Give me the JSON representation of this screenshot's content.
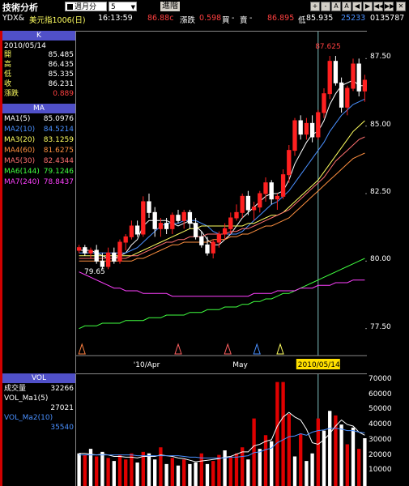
{
  "title": "技術分析",
  "toolbar": {
    "period_label": "週月分",
    "period_value": "5",
    "advanced_label": "進階",
    "buttons": [
      "A",
      "A",
      "+",
      "-",
      "◀",
      "▶",
      "◀◀",
      "▶▶",
      "✕"
    ]
  },
  "quote": {
    "symbol": "YDX&",
    "name": "美元指1006(日)",
    "time": "16:13:59",
    "last": "86.88c",
    "change_label": "漲跌",
    "change": "0.598",
    "bid_label": "買",
    "bid": "-",
    "ask_label": "賣",
    "ask": "86.895",
    "low_label": "低",
    "low": "85.935",
    "volume": "25233",
    "volume2": "0135787"
  },
  "k_panel": {
    "header": "K",
    "date": "2010/05/14",
    "rows": [
      {
        "label": "開",
        "value": "85.485"
      },
      {
        "label": "高",
        "value": "86.435"
      },
      {
        "label": "低",
        "value": "85.335"
      },
      {
        "label": "收",
        "value": "86.231"
      },
      {
        "label": "漲跌",
        "value": "0.889"
      }
    ]
  },
  "ma_panel": {
    "header": "MA",
    "rows": [
      {
        "label": "MA1(5)",
        "value": "85.0976",
        "color": "#ffffff"
      },
      {
        "label": "MA2(10)",
        "value": "84.5214",
        "color": "#4a90ff"
      },
      {
        "label": "MA3(20)",
        "value": "83.1259",
        "color": "#ffff60"
      },
      {
        "label": "MA4(60)",
        "value": "81.6275",
        "color": "#ff9040"
      },
      {
        "label": "MA5(30)",
        "value": "82.4344",
        "color": "#ff7070"
      },
      {
        "label": "MA6(144)",
        "value": "79.1246",
        "color": "#40ff40"
      },
      {
        "label": "MA7(240)",
        "value": "78.8437",
        "color": "#ff40ff"
      }
    ]
  },
  "vol_panel": {
    "header": "VOL",
    "rows": [
      {
        "label": "成交量",
        "value": "32266"
      },
      {
        "label": "VOL_Ma1(5)",
        "value": "27021"
      },
      {
        "label": "VOL_Ma2(10)",
        "value": "35540"
      }
    ]
  },
  "chart_data": {
    "type": "candlestick",
    "y_ticks": [
      "87.50",
      "85.00",
      "82.50",
      "80.00",
      "77.50"
    ],
    "ylim": [
      76.5,
      88.5
    ],
    "x_labels": [
      "'10/Apr",
      "May",
      "2010/05/14"
    ],
    "annotations": [
      {
        "text": "87.625",
        "price": 87.625
      },
      {
        "text": "79.65",
        "price": 79.65
      }
    ],
    "candles": [
      [
        80.4,
        80.6,
        80.3,
        80.5
      ],
      [
        80.5,
        80.6,
        80.2,
        80.3
      ],
      [
        80.3,
        80.5,
        80.1,
        80.4
      ],
      [
        80.4,
        80.6,
        79.9,
        80.0
      ],
      [
        80.0,
        80.3,
        79.7,
        79.8
      ],
      [
        79.8,
        80.5,
        79.7,
        80.3
      ],
      [
        80.3,
        80.5,
        79.9,
        80.0
      ],
      [
        80.0,
        80.8,
        79.9,
        80.7
      ],
      [
        80.7,
        81.0,
        80.4,
        80.9
      ],
      [
        80.9,
        81.5,
        80.8,
        81.3
      ],
      [
        81.3,
        81.5,
        80.9,
        81.0
      ],
      [
        81.0,
        82.4,
        80.9,
        82.2
      ],
      [
        82.2,
        82.5,
        81.6,
        81.8
      ],
      [
        81.8,
        82.0,
        80.9,
        81.2
      ],
      [
        81.2,
        81.6,
        80.9,
        81.4
      ],
      [
        81.4,
        81.6,
        81.0,
        81.2
      ],
      [
        81.2,
        81.8,
        81.0,
        81.7
      ],
      [
        81.7,
        81.9,
        81.4,
        81.5
      ],
      [
        81.5,
        81.9,
        81.2,
        81.8
      ],
      [
        81.8,
        81.9,
        81.2,
        81.4
      ],
      [
        81.4,
        81.6,
        80.8,
        80.9
      ],
      [
        80.9,
        81.1,
        80.5,
        80.6
      ],
      [
        80.6,
        80.9,
        80.2,
        80.3
      ],
      [
        80.3,
        80.8,
        80.1,
        80.7
      ],
      [
        80.7,
        81.1,
        80.5,
        81.0
      ],
      [
        81.0,
        81.4,
        80.8,
        81.2
      ],
      [
        81.2,
        81.8,
        81.0,
        81.6
      ],
      [
        81.6,
        82.1,
        81.5,
        81.8
      ],
      [
        81.8,
        82.5,
        81.6,
        82.4
      ],
      [
        82.4,
        82.6,
        81.7,
        81.9
      ],
      [
        81.9,
        82.2,
        81.5,
        82.0
      ],
      [
        82.0,
        82.6,
        81.8,
        82.5
      ],
      [
        82.5,
        83.1,
        82.2,
        82.9
      ],
      [
        82.9,
        83.0,
        82.1,
        82.3
      ],
      [
        82.3,
        82.5,
        81.9,
        82.4
      ],
      [
        82.4,
        83.4,
        82.3,
        83.2
      ],
      [
        83.2,
        84.3,
        82.9,
        84.1
      ],
      [
        84.1,
        85.3,
        83.9,
        85.2
      ],
      [
        85.2,
        85.4,
        84.5,
        84.7
      ],
      [
        84.7,
        85.3,
        84.5,
        85.1
      ],
      [
        85.1,
        85.4,
        84.4,
        84.6
      ],
      [
        84.6,
        85.6,
        84.5,
        85.5
      ],
      [
        85.5,
        86.4,
        85.3,
        86.2
      ],
      [
        86.2,
        87.6,
        86.0,
        87.4
      ],
      [
        87.4,
        87.6,
        86.5,
        86.6
      ],
      [
        86.6,
        86.8,
        85.5,
        85.7
      ],
      [
        85.7,
        86.5,
        85.4,
        86.4
      ],
      [
        86.4,
        87.5,
        86.3,
        87.3
      ],
      [
        87.3,
        87.5,
        86.1,
        86.3
      ],
      [
        86.3,
        86.9,
        85.9,
        86.7
      ]
    ],
    "ma_lines": [
      {
        "name": "MA1(5)",
        "color": "#ffffff",
        "values": [
          80.4,
          80.4,
          80.4,
          80.3,
          80.2,
          80.1,
          80.1,
          80.2,
          80.3,
          80.6,
          80.8,
          81.3,
          81.5,
          81.5,
          81.5,
          81.5,
          81.4,
          81.3,
          81.4,
          81.5,
          81.3,
          81.1,
          80.8,
          80.6,
          80.6,
          80.8,
          81.0,
          81.3,
          81.6,
          81.8,
          82.0,
          82.2,
          82.4,
          82.5,
          82.5,
          82.6,
          83.0,
          83.6,
          84.0,
          84.4,
          84.7,
          84.8,
          85.2,
          85.8,
          86.2,
          86.5,
          86.6,
          86.7,
          86.5,
          86.5
        ]
      },
      {
        "name": "MA2(10)",
        "color": "#4a90ff",
        "values": [
          80.3,
          80.3,
          80.3,
          80.3,
          80.3,
          80.3,
          80.3,
          80.3,
          80.3,
          80.4,
          80.5,
          80.7,
          80.9,
          81.1,
          81.3,
          81.4,
          81.4,
          81.4,
          81.5,
          81.5,
          81.5,
          81.4,
          81.3,
          81.1,
          81.0,
          81.0,
          81.0,
          81.0,
          81.1,
          81.3,
          81.5,
          81.7,
          81.9,
          82.1,
          82.2,
          82.4,
          82.6,
          82.9,
          83.2,
          83.5,
          83.8,
          84.1,
          84.4,
          84.8,
          85.1,
          85.4,
          85.6,
          85.8,
          85.9,
          86.0
        ]
      },
      {
        "name": "MA3(20)",
        "color": "#ffff60",
        "values": [
          80.2,
          80.2,
          80.2,
          80.2,
          80.2,
          80.2,
          80.2,
          80.2,
          80.2,
          80.2,
          80.3,
          80.4,
          80.5,
          80.6,
          80.7,
          80.8,
          80.9,
          81.0,
          81.1,
          81.2,
          81.2,
          81.3,
          81.3,
          81.3,
          81.3,
          81.3,
          81.3,
          81.3,
          81.3,
          81.4,
          81.4,
          81.5,
          81.6,
          81.7,
          81.7,
          81.8,
          82.0,
          82.2,
          82.4,
          82.6,
          82.8,
          83.0,
          83.3,
          83.6,
          83.9,
          84.2,
          84.5,
          84.8,
          85.0,
          85.2
        ]
      },
      {
        "name": "MA4(60)",
        "color": "#ff9040",
        "values": [
          80.0,
          80.0,
          80.0,
          80.0,
          80.0,
          80.0,
          80.0,
          80.0,
          80.0,
          80.0,
          80.1,
          80.1,
          80.2,
          80.3,
          80.4,
          80.5,
          80.6,
          80.6,
          80.7,
          80.7,
          80.7,
          80.7,
          80.7,
          80.8,
          80.8,
          80.8,
          80.9,
          80.9,
          81.0,
          81.0,
          81.1,
          81.2,
          81.3,
          81.3,
          81.4,
          81.5,
          81.6,
          81.8,
          82.0,
          82.2,
          82.4,
          82.6,
          82.8,
          83.0,
          83.2,
          83.4,
          83.6,
          83.8,
          83.9,
          84.0
        ]
      },
      {
        "name": "MA5(30)",
        "color": "#ff7070",
        "values": [
          80.1,
          80.1,
          80.1,
          80.1,
          80.1,
          80.1,
          80.1,
          80.1,
          80.1,
          80.2,
          80.2,
          80.3,
          80.4,
          80.5,
          80.6,
          80.7,
          80.7,
          80.8,
          80.8,
          80.9,
          80.9,
          80.9,
          81.0,
          81.0,
          81.0,
          81.0,
          81.1,
          81.1,
          81.2,
          81.2,
          81.3,
          81.4,
          81.5,
          81.6,
          81.7,
          81.8,
          81.9,
          82.1,
          82.3,
          82.5,
          82.7,
          82.9,
          83.1,
          83.4,
          83.7,
          83.9,
          84.1,
          84.3,
          84.5,
          84.6
        ]
      },
      {
        "name": "MA6(144)",
        "color": "#40ff40",
        "values": [
          77.5,
          77.6,
          77.6,
          77.6,
          77.7,
          77.7,
          77.7,
          77.7,
          77.8,
          77.8,
          77.8,
          77.8,
          77.9,
          77.9,
          77.9,
          78.0,
          78.0,
          78.0,
          78.0,
          78.1,
          78.1,
          78.1,
          78.2,
          78.2,
          78.2,
          78.3,
          78.3,
          78.3,
          78.4,
          78.4,
          78.5,
          78.5,
          78.6,
          78.6,
          78.7,
          78.8,
          78.8,
          78.9,
          79.0,
          79.1,
          79.2,
          79.3,
          79.4,
          79.5,
          79.6,
          79.7,
          79.8,
          79.9,
          80.0,
          80.1
        ]
      },
      {
        "name": "MA7(240)",
        "color": "#ff40ff",
        "values": [
          79.6,
          79.5,
          79.4,
          79.3,
          79.2,
          79.1,
          79.0,
          79.0,
          78.9,
          78.9,
          78.9,
          78.8,
          78.8,
          78.8,
          78.8,
          78.8,
          78.7,
          78.7,
          78.7,
          78.7,
          78.7,
          78.7,
          78.7,
          78.7,
          78.7,
          78.7,
          78.7,
          78.7,
          78.7,
          78.7,
          78.8,
          78.8,
          78.8,
          78.8,
          78.9,
          78.9,
          78.9,
          78.9,
          79.0,
          79.0,
          79.0,
          79.1,
          79.1,
          79.1,
          79.2,
          79.2,
          79.2,
          79.3,
          79.3,
          79.3
        ]
      }
    ],
    "vol_ticks": [
      "70000",
      "60000",
      "50000",
      "40000",
      "30000",
      "20000",
      "10000"
    ],
    "vol_ylim": [
      0,
      72000
    ],
    "volumes": [
      {
        "v": 22000,
        "c": "w"
      },
      {
        "v": 21000,
        "c": "r"
      },
      {
        "v": 25000,
        "c": "w"
      },
      {
        "v": 20000,
        "c": "r"
      },
      {
        "v": 23000,
        "c": "w"
      },
      {
        "v": 19000,
        "c": "r"
      },
      {
        "v": 17000,
        "c": "w"
      },
      {
        "v": 21000,
        "c": "r"
      },
      {
        "v": 18000,
        "c": "r"
      },
      {
        "v": 22000,
        "c": "r"
      },
      {
        "v": 16000,
        "c": "w"
      },
      {
        "v": 23000,
        "c": "r"
      },
      {
        "v": 22000,
        "c": "w"
      },
      {
        "v": 18000,
        "c": "w"
      },
      {
        "v": 26000,
        "c": "r"
      },
      {
        "v": 15000,
        "c": "w"
      },
      {
        "v": 19000,
        "c": "r"
      },
      {
        "v": 14000,
        "c": "w"
      },
      {
        "v": 18000,
        "c": "r"
      },
      {
        "v": 15000,
        "c": "w"
      },
      {
        "v": 16000,
        "c": "w"
      },
      {
        "v": 22000,
        "c": "r"
      },
      {
        "v": 15000,
        "c": "w"
      },
      {
        "v": 17000,
        "c": "r"
      },
      {
        "v": 21000,
        "c": "r"
      },
      {
        "v": 24000,
        "c": "w"
      },
      {
        "v": 20000,
        "c": "r"
      },
      {
        "v": 22000,
        "c": "r"
      },
      {
        "v": 26000,
        "c": "r"
      },
      {
        "v": 18000,
        "c": "w"
      },
      {
        "v": 45000,
        "c": "r"
      },
      {
        "v": 25000,
        "c": "w"
      },
      {
        "v": 34000,
        "c": "r"
      },
      {
        "v": 30000,
        "c": "w"
      },
      {
        "v": 69000,
        "c": "r"
      },
      {
        "v": 69000,
        "c": "r"
      },
      {
        "v": 48000,
        "c": "r"
      },
      {
        "v": 20000,
        "c": "w"
      },
      {
        "v": 35000,
        "c": "r"
      },
      {
        "v": 17000,
        "c": "w"
      },
      {
        "v": 22000,
        "c": "w"
      },
      {
        "v": 45000,
        "c": "r"
      },
      {
        "v": 37000,
        "c": "w"
      },
      {
        "v": 50000,
        "c": "w"
      },
      {
        "v": 47000,
        "c": "r"
      },
      {
        "v": 41000,
        "c": "w"
      },
      {
        "v": 28000,
        "c": "r"
      },
      {
        "v": 39000,
        "c": "w"
      },
      {
        "v": 25000,
        "c": "r"
      },
      {
        "v": 32000,
        "c": "w"
      }
    ],
    "vol_ma1": [
      22000,
      22000,
      21500,
      21000,
      21500,
      21000,
      20000,
      20000,
      19500,
      19500,
      19000,
      20000,
      20000,
      20000,
      21000,
      20500,
      20000,
      19000,
      18500,
      17500,
      16500,
      17000,
      17500,
      18000,
      18500,
      19500,
      20000,
      21500,
      23000,
      23000,
      27000,
      28000,
      30000,
      31000,
      40000,
      46000,
      49000,
      46000,
      44000,
      38000,
      29000,
      28000,
      31000,
      35000,
      40000,
      44000,
      41000,
      40000,
      36000,
      34000
    ],
    "vol_ma2": [
      21000,
      21000,
      21000,
      21000,
      21000,
      21000,
      21000,
      21000,
      21000,
      21000,
      20500,
      20500,
      20500,
      20500,
      20500,
      20500,
      20500,
      20500,
      20000,
      19500,
      19500,
      19000,
      19000,
      19000,
      19000,
      19000,
      19500,
      19500,
      20000,
      20500,
      22500,
      23000,
      24500,
      25500,
      29000,
      31000,
      33000,
      33500,
      35000,
      34000,
      36000,
      37000,
      37500,
      38500,
      38500,
      38000,
      37000,
      37000,
      36000,
      35500
    ]
  }
}
